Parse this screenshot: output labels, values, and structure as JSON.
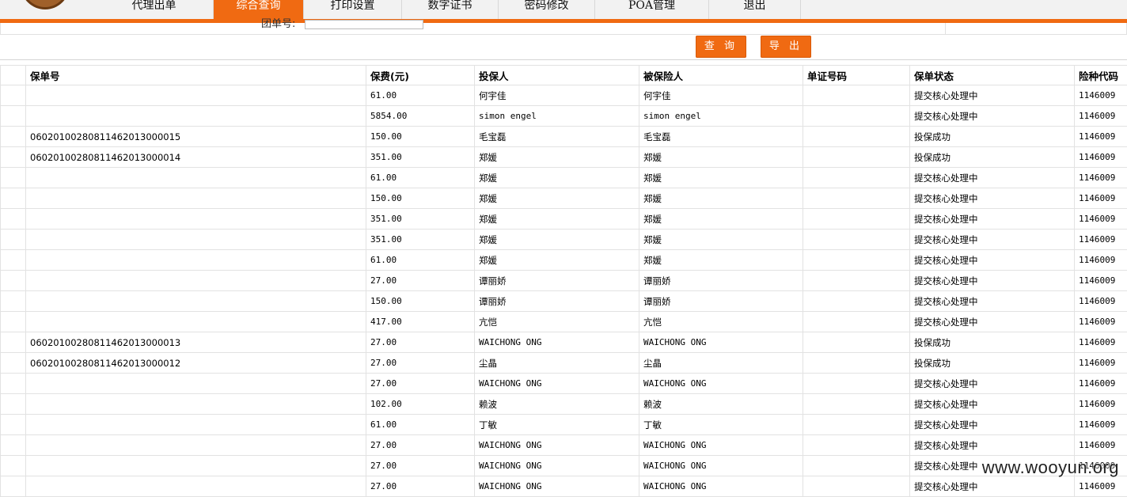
{
  "nav": {
    "tabs": [
      {
        "label": "代理出单",
        "active": false
      },
      {
        "label": "综合查询",
        "active": true
      },
      {
        "label": "打印设置",
        "active": false
      },
      {
        "label": "数字证书",
        "active": false
      },
      {
        "label": "密码修改",
        "active": false
      },
      {
        "label": "POA管理",
        "active": false
      },
      {
        "label": "退出",
        "active": false
      }
    ]
  },
  "search": {
    "label": "团单号:",
    "value": ""
  },
  "buttons": {
    "query": "查 询",
    "export": "导 出"
  },
  "colors": {
    "accent": "#f06a12"
  },
  "table": {
    "headers": [
      "",
      "保单号",
      "保费(元)",
      "投保人",
      "被保险人",
      "单证号码",
      "保单状态",
      "险种代码"
    ],
    "rows": [
      [
        "",
        "",
        "61.00",
        "何宇佳",
        "何宇佳",
        "",
        "提交核心处理中",
        "1146009"
      ],
      [
        "",
        "",
        "5854.00",
        "simon engel",
        "simon engel",
        "",
        "提交核心处理中",
        "1146009"
      ],
      [
        "",
        "0602010028081146201300​0015",
        "150.00",
        "毛宝磊",
        "毛宝磊",
        "",
        "投保成功",
        "1146009"
      ],
      [
        "",
        "0602010028081146201300​0014",
        "351.00",
        "郑媛",
        "郑媛",
        "",
        "投保成功",
        "1146009"
      ],
      [
        "",
        "",
        "61.00",
        "郑媛",
        "郑媛",
        "",
        "提交核心处理中",
        "1146009"
      ],
      [
        "",
        "",
        "150.00",
        "郑媛",
        "郑媛",
        "",
        "提交核心处理中",
        "1146009"
      ],
      [
        "",
        "",
        "351.00",
        "郑媛",
        "郑媛",
        "",
        "提交核心处理中",
        "1146009"
      ],
      [
        "",
        "",
        "351.00",
        "郑媛",
        "郑媛",
        "",
        "提交核心处理中",
        "1146009"
      ],
      [
        "",
        "",
        "61.00",
        "郑媛",
        "郑媛",
        "",
        "提交核心处理中",
        "1146009"
      ],
      [
        "",
        "",
        "27.00",
        "谭丽娇",
        "谭丽娇",
        "",
        "提交核心处理中",
        "1146009"
      ],
      [
        "",
        "",
        "150.00",
        "谭丽娇",
        "谭丽娇",
        "",
        "提交核心处理中",
        "1146009"
      ],
      [
        "",
        "",
        "417.00",
        "亢恺",
        "亢恺",
        "",
        "提交核心处理中",
        "1146009"
      ],
      [
        "",
        "0602010028081146201300​0013",
        "27.00",
        "WAICHONG ONG",
        "WAICHONG ONG",
        "",
        "投保成功",
        "1146009"
      ],
      [
        "",
        "0602010028081146201300​0012",
        "27.00",
        "尘晶",
        "尘晶",
        "",
        "投保成功",
        "1146009"
      ],
      [
        "",
        "",
        "27.00",
        "WAICHONG ONG",
        "WAICHONG ONG",
        "",
        "提交核心处理中",
        "1146009"
      ],
      [
        "",
        "",
        "102.00",
        "赖波",
        "赖波",
        "",
        "提交核心处理中",
        "1146009"
      ],
      [
        "",
        "",
        "61.00",
        "丁敏",
        "丁敏",
        "",
        "提交核心处理中",
        "1146009"
      ],
      [
        "",
        "",
        "27.00",
        "WAICHONG ONG",
        "WAICHONG ONG",
        "",
        "提交核心处理中",
        "1146009"
      ],
      [
        "",
        "",
        "27.00",
        "WAICHONG ONG",
        "WAICHONG ONG",
        "",
        "提交核心处理中",
        "1146009"
      ],
      [
        "",
        "",
        "27.00",
        "WAICHONG ONG",
        "WAICHONG ONG",
        "",
        "提交核心处理中",
        "1146009"
      ]
    ]
  },
  "watermark": "www.wooyun.org"
}
